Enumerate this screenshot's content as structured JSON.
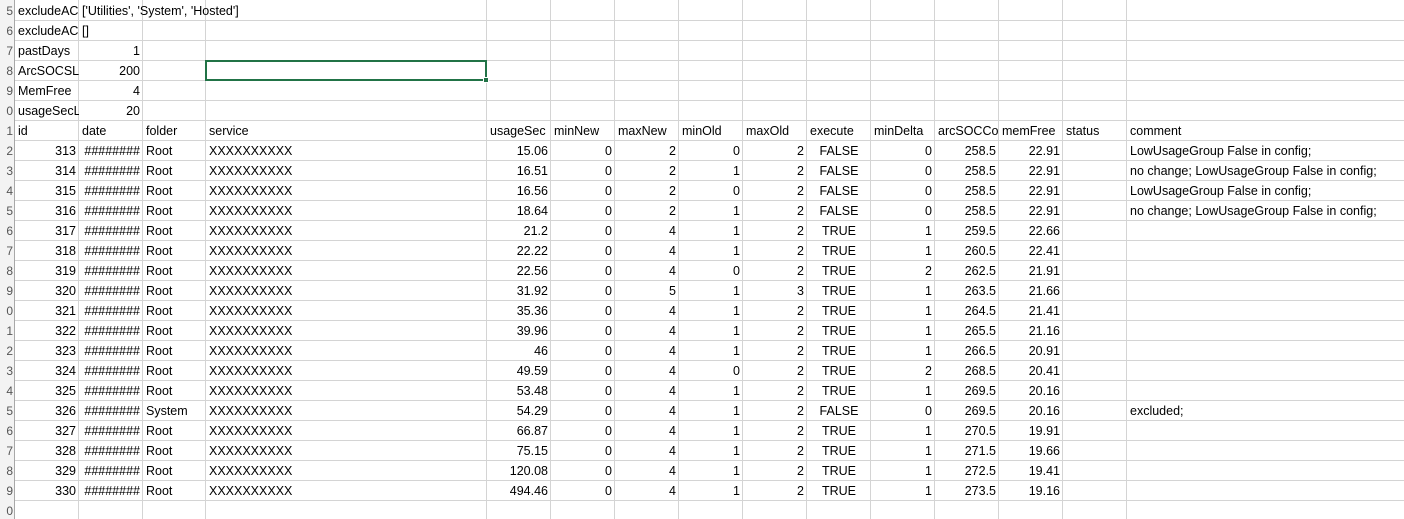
{
  "config_rows": [
    {
      "row": "5",
      "key": "excludeAC",
      "value": "['Utilities', 'System', 'Hosted']"
    },
    {
      "row": "6",
      "key": "excludeAC",
      "value": "[]"
    },
    {
      "row": "7",
      "key": "pastDays",
      "value": "1"
    },
    {
      "row": "8",
      "key": "ArcSOCSLA",
      "value": "200"
    },
    {
      "row": "9",
      "key": "MemFree",
      "value": "4"
    },
    {
      "row": "0",
      "key": "usageSecL",
      "value": "20"
    }
  ],
  "header_row": {
    "row": "1",
    "labels": [
      "id",
      "date",
      "folder",
      "service",
      "usageSec",
      "minNew",
      "maxNew",
      "minOld",
      "maxOld",
      "execute",
      "minDelta",
      "arcSOCCount",
      "memFree",
      "status",
      "comment"
    ]
  },
  "data_rows": [
    {
      "row": "2",
      "values": [
        "313",
        "########",
        "Root",
        "XXXXXXXXXX",
        "15.06",
        "0",
        "2",
        "0",
        "2",
        "FALSE",
        "0",
        "258.5",
        "22.91",
        "",
        "LowUsageGroup False in config;"
      ]
    },
    {
      "row": "3",
      "values": [
        "314",
        "########",
        "Root",
        "XXXXXXXXXX",
        "16.51",
        "0",
        "2",
        "1",
        "2",
        "FALSE",
        "0",
        "258.5",
        "22.91",
        "",
        "no change; LowUsageGroup False in config;"
      ]
    },
    {
      "row": "4",
      "values": [
        "315",
        "########",
        "Root",
        "XXXXXXXXXX",
        "16.56",
        "0",
        "2",
        "0",
        "2",
        "FALSE",
        "0",
        "258.5",
        "22.91",
        "",
        "LowUsageGroup False in config;"
      ]
    },
    {
      "row": "5",
      "values": [
        "316",
        "########",
        "Root",
        "XXXXXXXXXX",
        "18.64",
        "0",
        "2",
        "1",
        "2",
        "FALSE",
        "0",
        "258.5",
        "22.91",
        "",
        "no change; LowUsageGroup False in config;"
      ]
    },
    {
      "row": "6",
      "values": [
        "317",
        "########",
        "Root",
        "XXXXXXXXXX",
        "21.2",
        "0",
        "4",
        "1",
        "2",
        "TRUE",
        "1",
        "259.5",
        "22.66",
        "",
        ""
      ]
    },
    {
      "row": "7",
      "values": [
        "318",
        "########",
        "Root",
        "XXXXXXXXXX",
        "22.22",
        "0",
        "4",
        "1",
        "2",
        "TRUE",
        "1",
        "260.5",
        "22.41",
        "",
        ""
      ]
    },
    {
      "row": "8",
      "values": [
        "319",
        "########",
        "Root",
        "XXXXXXXXXX",
        "22.56",
        "0",
        "4",
        "0",
        "2",
        "TRUE",
        "2",
        "262.5",
        "21.91",
        "",
        ""
      ]
    },
    {
      "row": "9",
      "values": [
        "320",
        "########",
        "Root",
        "XXXXXXXXXX",
        "31.92",
        "0",
        "5",
        "1",
        "3",
        "TRUE",
        "1",
        "263.5",
        "21.66",
        "",
        ""
      ]
    },
    {
      "row": "0",
      "values": [
        "321",
        "########",
        "Root",
        "XXXXXXXXXX",
        "35.36",
        "0",
        "4",
        "1",
        "2",
        "TRUE",
        "1",
        "264.5",
        "21.41",
        "",
        ""
      ]
    },
    {
      "row": "1",
      "values": [
        "322",
        "########",
        "Root",
        "XXXXXXXXXX",
        "39.96",
        "0",
        "4",
        "1",
        "2",
        "TRUE",
        "1",
        "265.5",
        "21.16",
        "",
        ""
      ]
    },
    {
      "row": "2",
      "values": [
        "323",
        "########",
        "Root",
        "XXXXXXXXXX",
        "46",
        "0",
        "4",
        "1",
        "2",
        "TRUE",
        "1",
        "266.5",
        "20.91",
        "",
        ""
      ]
    },
    {
      "row": "3",
      "values": [
        "324",
        "########",
        "Root",
        "XXXXXXXXXX",
        "49.59",
        "0",
        "4",
        "0",
        "2",
        "TRUE",
        "2",
        "268.5",
        "20.41",
        "",
        ""
      ]
    },
    {
      "row": "4",
      "values": [
        "325",
        "########",
        "Root",
        "XXXXXXXXXX",
        "53.48",
        "0",
        "4",
        "1",
        "2",
        "TRUE",
        "1",
        "269.5",
        "20.16",
        "",
        ""
      ]
    },
    {
      "row": "5",
      "values": [
        "326",
        "########",
        "System",
        "XXXXXXXXXX",
        "54.29",
        "0",
        "4",
        "1",
        "2",
        "FALSE",
        "0",
        "269.5",
        "20.16",
        "",
        "excluded;"
      ]
    },
    {
      "row": "6",
      "values": [
        "327",
        "########",
        "Root",
        "XXXXXXXXXX",
        "66.87",
        "0",
        "4",
        "1",
        "2",
        "TRUE",
        "1",
        "270.5",
        "19.91",
        "",
        ""
      ]
    },
    {
      "row": "7",
      "values": [
        "328",
        "########",
        "Root",
        "XXXXXXXXXX",
        "75.15",
        "0",
        "4",
        "1",
        "2",
        "TRUE",
        "1",
        "271.5",
        "19.66",
        "",
        ""
      ]
    },
    {
      "row": "8",
      "values": [
        "329",
        "########",
        "Root",
        "XXXXXXXXXX",
        "120.08",
        "0",
        "4",
        "1",
        "2",
        "TRUE",
        "1",
        "272.5",
        "19.41",
        "",
        ""
      ]
    },
    {
      "row": "9",
      "values": [
        "330",
        "########",
        "Root",
        "XXXXXXXXXX",
        "494.46",
        "0",
        "4",
        "1",
        "2",
        "TRUE",
        "1",
        "273.5",
        "19.16",
        "",
        ""
      ]
    }
  ],
  "trailing_row": {
    "row": "0"
  }
}
